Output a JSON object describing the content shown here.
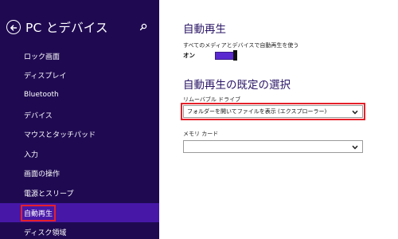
{
  "nav": {
    "title": "PC とデバイス",
    "items": [
      {
        "label": "ロック画面"
      },
      {
        "label": "ディスプレイ"
      },
      {
        "label": "Bluetooth"
      },
      {
        "label": "デバイス"
      },
      {
        "label": "マウスとタッチパッド"
      },
      {
        "label": "入力"
      },
      {
        "label": "画面の操作"
      },
      {
        "label": "電源とスリープ"
      },
      {
        "label": "自動再生",
        "selected": true
      },
      {
        "label": "ディスク領域"
      }
    ],
    "background_color": "#1f0a52",
    "selected_color": "#4718a8",
    "icons": {
      "back": "back-arrow-icon",
      "search": "search-icon"
    }
  },
  "autoplay": {
    "heading": "自動再生",
    "toggle_label": "すべてのメディアとデバイスで自動再生を使う",
    "toggle_state_text": "オン",
    "toggle_on": true
  },
  "defaults": {
    "heading": "自動再生の既定の選択",
    "removable_label": "リムーバブル ドライブ",
    "removable_value": "フォルダーを開いてファイルを表示 (エクスプローラー)",
    "memory_card_label": "メモリ カード",
    "memory_card_value": ""
  },
  "accent_color": "#5a2ad0",
  "highlight_color": "#e6202a"
}
